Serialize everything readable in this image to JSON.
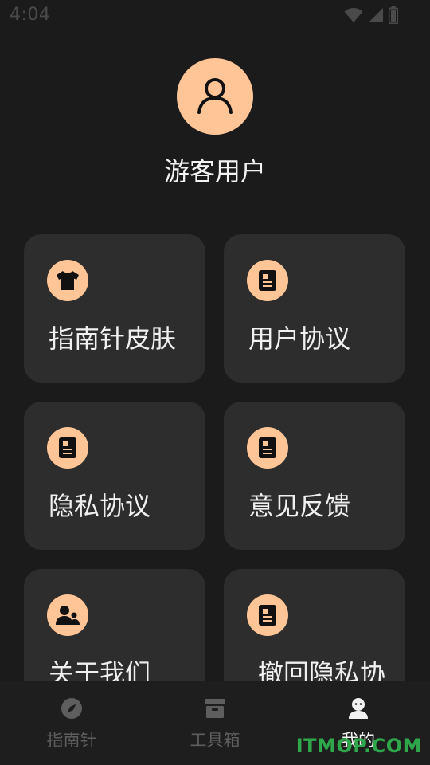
{
  "status_bar": {
    "time": "4:04",
    "icons": [
      "wifi-icon",
      "cellular-icon",
      "battery-icon"
    ]
  },
  "profile": {
    "avatar_icon": "user-icon",
    "name": "游客用户"
  },
  "cards": [
    {
      "label": "指南针皮肤",
      "icon": "tshirt-icon"
    },
    {
      "label": "用户协议",
      "icon": "document-icon"
    },
    {
      "label": "隐私协议",
      "icon": "document-icon"
    },
    {
      "label": "意见反馈",
      "icon": "document-icon"
    },
    {
      "label": "关于我们",
      "icon": "people-icon"
    },
    {
      "label": "撤回隐私协",
      "icon": "document-icon"
    }
  ],
  "bottom_nav": {
    "items": [
      {
        "label": "指南针",
        "icon": "compass-icon",
        "active": false
      },
      {
        "label": "工具箱",
        "icon": "toolbox-icon",
        "active": false
      },
      {
        "label": "我的",
        "icon": "profile-icon",
        "active": true
      }
    ]
  },
  "watermark": "ITMOP.COM",
  "colors": {
    "background": "#1b1b1b",
    "card": "#2d2d2d",
    "accent": "#ffc596",
    "nav_inactive": "#5e5e5e",
    "nav_active": "#f2f2f2"
  }
}
